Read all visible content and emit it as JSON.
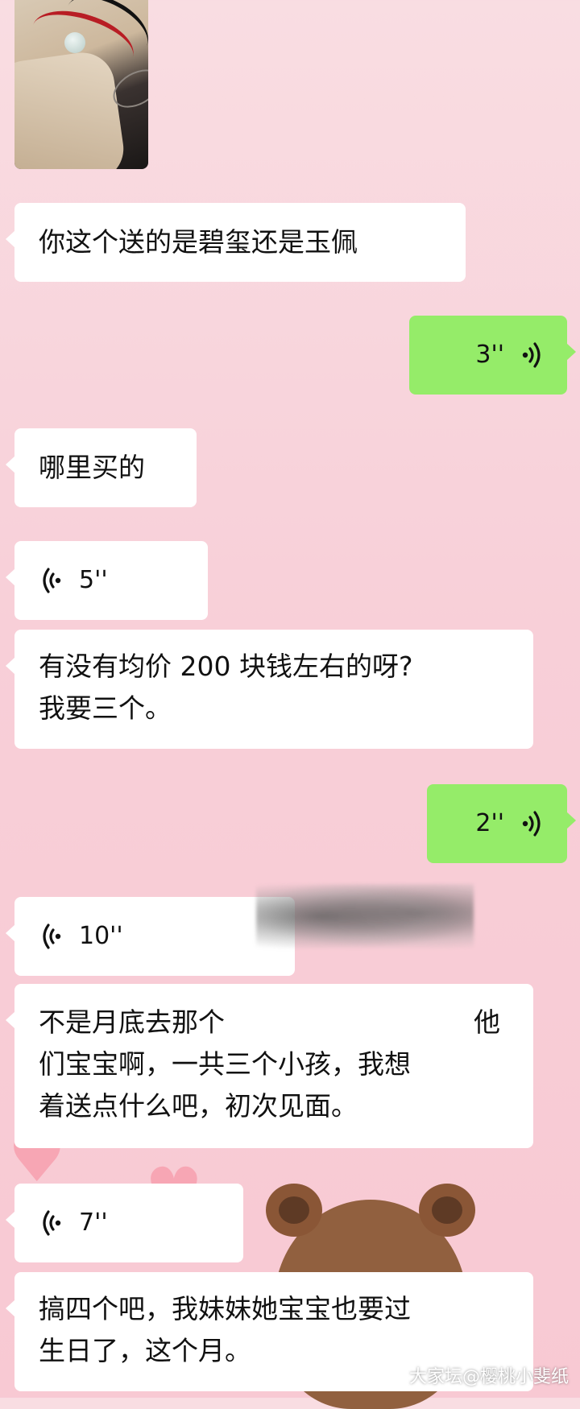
{
  "chat": {
    "messages": [
      {
        "side": "left",
        "type": "text",
        "lines": [
          "你这个送的是碧玺还是玉佩"
        ]
      },
      {
        "side": "right",
        "type": "voice",
        "duration": "3''"
      },
      {
        "side": "left",
        "type": "text",
        "lines": [
          "哪里买的"
        ]
      },
      {
        "side": "left",
        "type": "voice",
        "duration": "5''"
      },
      {
        "side": "left",
        "type": "text",
        "lines": [
          "有没有均价 200 块钱左右的呀?",
          "我要三个。"
        ]
      },
      {
        "side": "right",
        "type": "voice",
        "duration": "2''"
      },
      {
        "side": "left",
        "type": "voice",
        "duration": "10''"
      },
      {
        "side": "left",
        "type": "text",
        "lines": [
          "不是月底去那个",
          "他",
          "们宝宝啊，一共三个小孩，我想",
          "着送点什么吧，初次见面。"
        ]
      },
      {
        "side": "left",
        "type": "voice",
        "duration": "7''"
      },
      {
        "side": "left",
        "type": "text",
        "lines": [
          "搞四个吧，我妹妹她宝宝也要过",
          "生日了，这个月。"
        ]
      }
    ]
  },
  "watermark": "大家坛@樱桃小斐纸",
  "colors": {
    "outgoing": "#95ec69",
    "incoming": "#ffffff"
  },
  "icons": {
    "voice": "voice-wave-icon"
  }
}
